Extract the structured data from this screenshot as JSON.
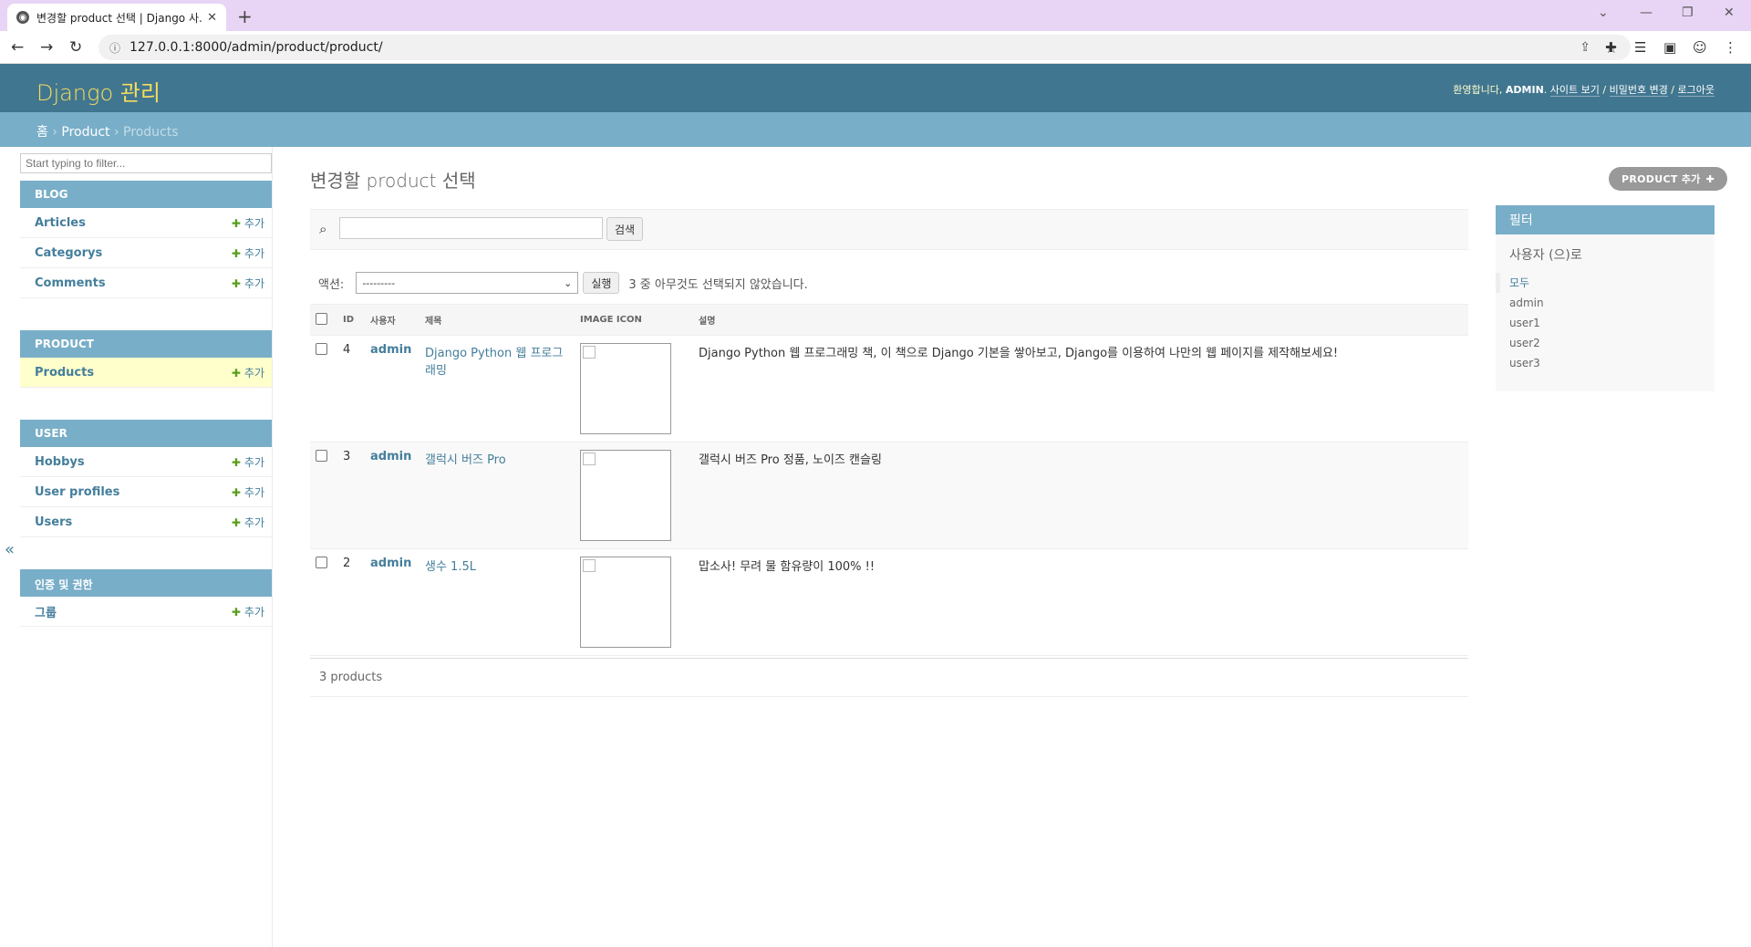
{
  "browser": {
    "tab_title": "변경할 product 선택 | Django 사...",
    "url": "127.0.0.1:8000/admin/product/product/"
  },
  "header": {
    "branding": "Django 관리",
    "welcome": "환영합니다,",
    "username": "ADMIN",
    "view_site": "사이트 보기",
    "change_password": "비밀번호 변경",
    "logout": "로그아웃",
    "sep": " / "
  },
  "breadcrumbs": {
    "home": "홈",
    "app": "Product",
    "current": "Products",
    "sep": " › "
  },
  "sidebar": {
    "filter_placeholder": "Start typing to filter...",
    "add_label": "추가",
    "modules": [
      {
        "caption": "BLOG",
        "items": [
          "Articles",
          "Categorys",
          "Comments"
        ]
      },
      {
        "caption": "PRODUCT",
        "items": [
          "Products"
        ]
      },
      {
        "caption": "USER",
        "items": [
          "Hobbys",
          "User profiles",
          "Users"
        ]
      },
      {
        "caption": "인증 및 권한",
        "items": [
          "그룹"
        ]
      }
    ],
    "collapse_glyph": "«"
  },
  "content": {
    "title": "변경할 product 선택",
    "add_button": "PRODUCT 추가",
    "search_button": "검색",
    "action_label": "액션:",
    "action_selected": "---------",
    "run_button": "실행",
    "selection_counter": "3 중 아무것도 선택되지 않았습니다.",
    "columns": [
      "ID",
      "사용자",
      "제목",
      "IMAGE ICON",
      "설명"
    ],
    "rows": [
      {
        "id": "4",
        "user": "admin",
        "title": "Django Python 웹 프로그래밍",
        "desc": "Django Python 웹 프로그래밍 책, 이 책으로 Django 기본을 쌓아보고, Django를 이용하여 나만의 웹 페이지를 제작해보세요!"
      },
      {
        "id": "3",
        "user": "admin",
        "title": "갤럭시 버즈 Pro",
        "desc": "갤럭시 버즈 Pro 정품, 노이즈 캔슬링"
      },
      {
        "id": "2",
        "user": "admin",
        "title": "생수 1.5L",
        "desc": "맙소사! 무려 물 함유량이 100% !!"
      }
    ],
    "paginator": "3 products"
  },
  "filter": {
    "title": "필터",
    "by": "사용자 (으)로",
    "items": [
      "모두",
      "admin",
      "user1",
      "user2",
      "user3"
    ]
  }
}
